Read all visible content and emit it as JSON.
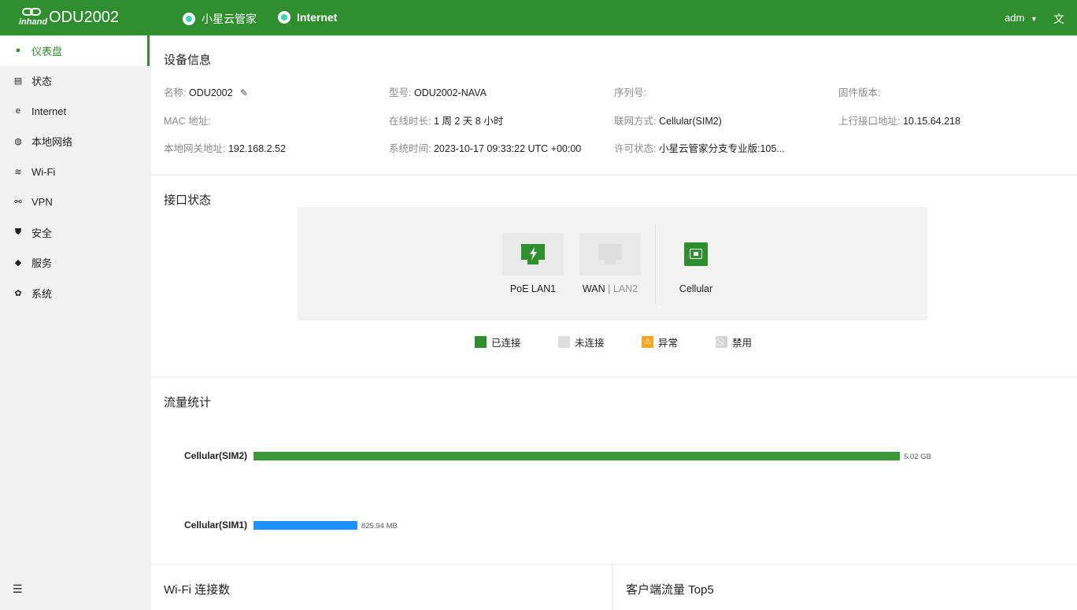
{
  "header": {
    "brand": "inhand",
    "product": "ODU2002",
    "cloud_status": "小星云管家",
    "internet_status": "Internet",
    "user": "adm",
    "lang_icon": "translate-icon"
  },
  "sidebar": {
    "items": [
      {
        "label": "仪表盘",
        "icon": "dashboard-icon"
      },
      {
        "label": "状态",
        "icon": "status-icon"
      },
      {
        "label": "Internet",
        "icon": "internet-icon"
      },
      {
        "label": "本地网络",
        "icon": "globe-icon"
      },
      {
        "label": "Wi-Fi",
        "icon": "wifi-icon"
      },
      {
        "label": "VPN",
        "icon": "vpn-icon"
      },
      {
        "label": "安全",
        "icon": "shield-icon"
      },
      {
        "label": "服务",
        "icon": "cube-icon"
      },
      {
        "label": "系统",
        "icon": "gear-icon"
      }
    ]
  },
  "device_info": {
    "title": "设备信息",
    "name_k": "名称:",
    "name_v": "ODU2002",
    "model_k": "型号:",
    "model_v": "ODU2002-NAVA",
    "serial_k": "序列号:",
    "serial_v": "",
    "firmware_k": "固件版本:",
    "firmware_v": "",
    "mac_k": "MAC 地址:",
    "mac_v": "",
    "uptime_k": "在线时长:",
    "uptime_v": "1 周 2 天 8 小时",
    "wan_mode_k": "联网方式:",
    "wan_mode_v": "Cellular(SIM2)",
    "uplink_ip_k": "上行接口地址:",
    "uplink_ip_v": "10.15.64.218",
    "lan_gw_k": "本地网关地址:",
    "lan_gw_v": "192.168.2.52",
    "sys_time_k": "系统时间:",
    "sys_time_v": "2023-10-17 09:33:22 UTC +00:00",
    "license_k": "许可状态:",
    "license_v": "小星云管家分支专业版:105..."
  },
  "interfaces": {
    "title": "接口状态",
    "poe_label": "PoE LAN1",
    "wan_label": "WAN",
    "wan_sep": " | ",
    "wan_alt": "LAN2",
    "cell_label": "Cellular",
    "legend": {
      "connected": "已连接",
      "disconnected": "未连接",
      "abnormal": "异常",
      "disabled": "禁用"
    },
    "colors": {
      "connected": "#2f8f2f",
      "disconnected": "#dedede",
      "abnormal": "#f5a623",
      "disabled": "#c8c8c8"
    }
  },
  "traffic": {
    "title": "流量统计",
    "chart_data": {
      "type": "bar",
      "categories": [
        "Cellular(SIM2)",
        "Cellular(SIM1)"
      ],
      "values_mb": [
        5140.48,
        825.94
      ],
      "value_labels": [
        "5.02 GB",
        "825.94 MB"
      ],
      "colors": [
        "#3a9a3a",
        "#1e90ff"
      ]
    }
  },
  "bottom": {
    "wifi_title": "Wi-Fi 连接数",
    "top5_title": "客户端流量 Top5"
  }
}
